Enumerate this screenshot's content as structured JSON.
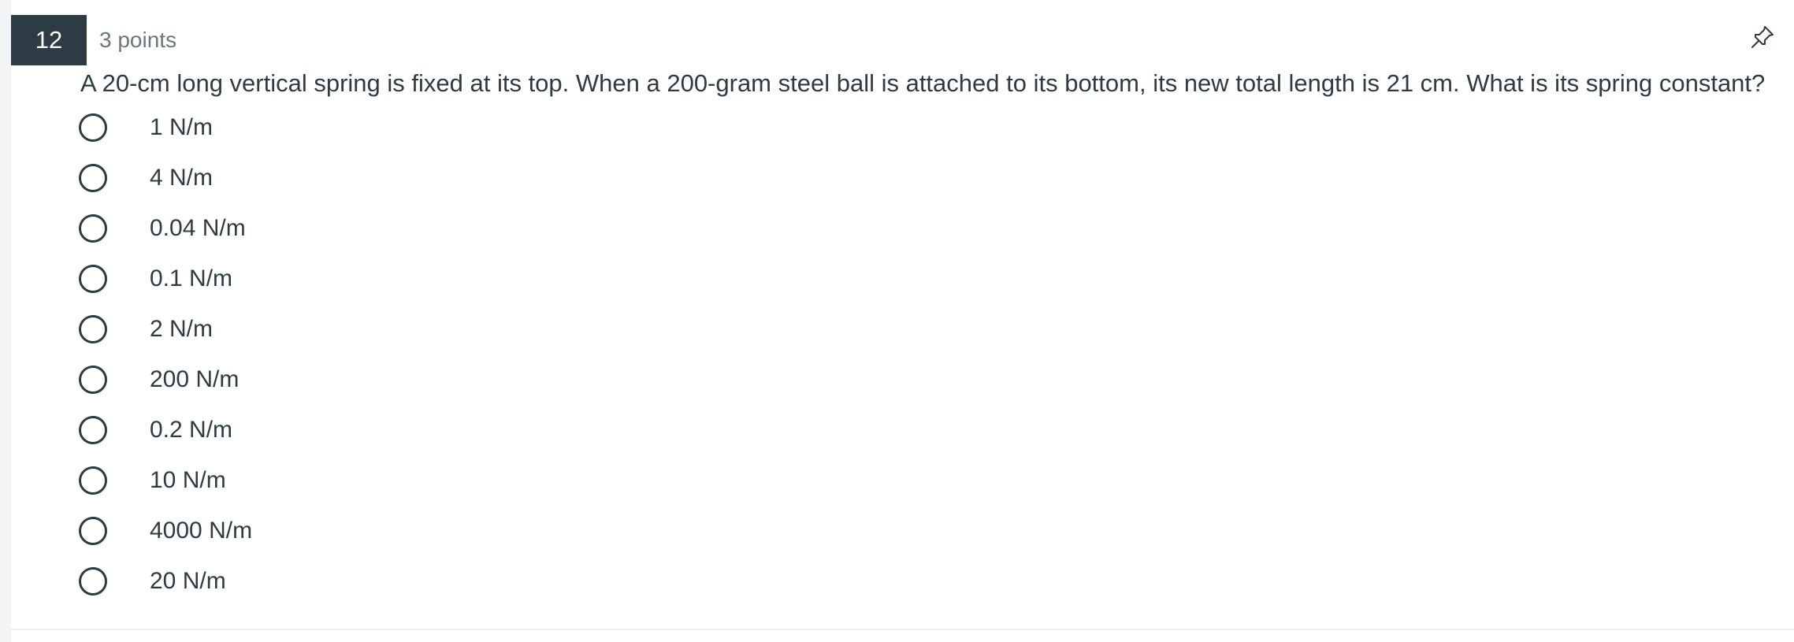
{
  "question": {
    "number": "12",
    "points": "3 points",
    "text": "A 20-cm long vertical spring is fixed at its top. When a 200-gram steel ball is attached to its bottom, its new total length is 21 cm. What is its spring constant?",
    "options": [
      {
        "label": "1 N/m"
      },
      {
        "label": "4 N/m"
      },
      {
        "label": "0.04 N/m"
      },
      {
        "label": "0.1 N/m"
      },
      {
        "label": "2 N/m"
      },
      {
        "label": "200 N/m"
      },
      {
        "label": "0.2 N/m"
      },
      {
        "label": "10 N/m"
      },
      {
        "label": "4000 N/m"
      },
      {
        "label": "20 N/m"
      }
    ]
  },
  "icons": {
    "pin": "pin-icon",
    "radio": "radio-unchecked-icon"
  },
  "colors": {
    "number_badge_bg": "#2d3b45",
    "text": "#2d3b45",
    "muted_text": "#6b7780"
  }
}
